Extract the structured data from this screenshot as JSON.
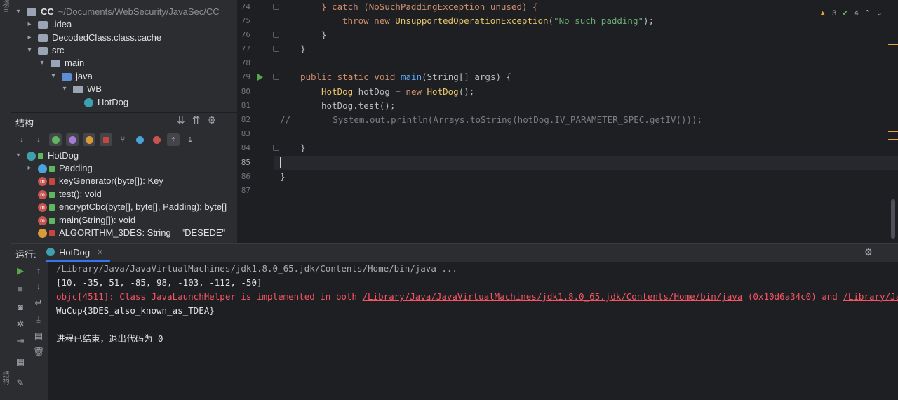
{
  "project": {
    "root_name": "CC",
    "root_path": "~/Documents/WebSecurity/JavaSec/CC",
    "items": [
      {
        "label": ".idea"
      },
      {
        "label": "DecodedClass.class.cache"
      },
      {
        "label": "src"
      },
      {
        "label": "main"
      },
      {
        "label": "java"
      },
      {
        "label": "WB"
      },
      {
        "label": "HotDog"
      }
    ]
  },
  "structure": {
    "title": "结构",
    "root": "HotDog",
    "members": [
      {
        "label": "Padding"
      },
      {
        "label": "keyGenerator(byte[]): Key"
      },
      {
        "label": "test(): void"
      },
      {
        "label": "encryptCbc(byte[], byte[], Padding): byte[]"
      },
      {
        "label": "main(String[]): void"
      },
      {
        "label": "ALGORITHM_3DES: String = \"DESEDE\""
      }
    ]
  },
  "left_strip": {
    "top_tab": "项目",
    "bottom_tab": "结构"
  },
  "editor": {
    "line_numbers": [
      "74",
      "75",
      "76",
      "77",
      "78",
      "79",
      "80",
      "81",
      "82",
      "83",
      "84",
      "85",
      "86",
      "87"
    ],
    "lines": {
      "l74": "} catch (NoSuchPaddingException unused) {",
      "l75_kw1": "throw",
      "l75_kw2": "new",
      "l75_cls": "UnsupportedOperationException",
      "l75_str": "\"No such padding\"",
      "l75_end": ");",
      "l76": "}",
      "l77": "}",
      "l79_kw": "public static void",
      "l79_fn": "main",
      "l79_rest": "(String[] args) {",
      "l80_cls": "HotDog",
      "l80_mid": " hotDog = ",
      "l80_kw": "new",
      "l80_cls2": "HotDog",
      "l80_end": "();",
      "l81": "hotDog.test();",
      "l82_slash": "//",
      "l82_code": "System.out.println(Arrays.toString(hotDog.IV_PARAMETER_SPEC.getIV()));",
      "l84": "}",
      "l86": "}"
    },
    "warnings": "3",
    "checks": "4"
  },
  "run": {
    "label": "运行:",
    "tab": "HotDog",
    "console": {
      "cmd": "/Library/Java/JavaVirtualMachines/jdk1.8.0_65.jdk/Contents/Home/bin/java ...",
      "array": "[10, -35, 51, -85, 98, -103, -112, -50]",
      "err_prefix": "objc[4511]: Class JavaLaunchHelper is implemented in both ",
      "err_link1": "/Library/Java/JavaVirtualMachines/jdk1.8.0_65.jdk/Contents/Home/bin/java",
      "err_mid": " (0x10d6a34c0) and ",
      "err_link2": "/Library/Java",
      "flag": "WuCup{3DES_also_known_as_TDEA}",
      "exit": "进程已结束，退出代码为 0"
    }
  },
  "colors": {
    "accent": "#3574f0",
    "error": "#f75464",
    "warning": "#e8a33c",
    "success": "#5fb85f"
  }
}
